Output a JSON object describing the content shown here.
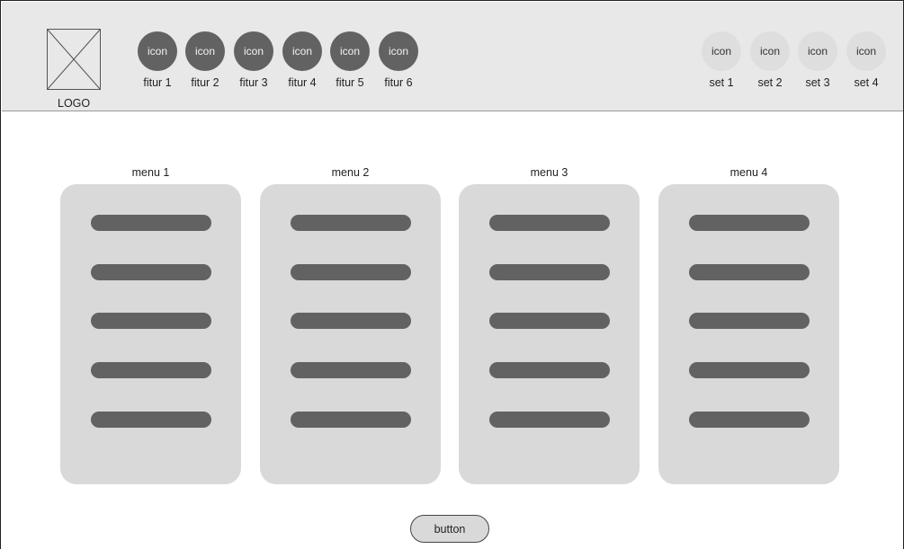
{
  "header": {
    "logo_label": "LOGO",
    "features": [
      {
        "icon_text": "icon",
        "label": "fitur 1"
      },
      {
        "icon_text": "icon",
        "label": "fitur 2"
      },
      {
        "icon_text": "icon",
        "label": "fitur 3"
      },
      {
        "icon_text": "icon",
        "label": "fitur 4"
      },
      {
        "icon_text": "icon",
        "label": "fitur 5"
      },
      {
        "icon_text": "icon",
        "label": "fitur 6"
      }
    ],
    "settings": [
      {
        "icon_text": "icon",
        "label": "set 1"
      },
      {
        "icon_text": "icon",
        "label": "set 2"
      },
      {
        "icon_text": "icon",
        "label": "set 3"
      },
      {
        "icon_text": "icon",
        "label": "set 4"
      }
    ]
  },
  "menus": [
    {
      "title": "menu 1"
    },
    {
      "title": "menu 2"
    },
    {
      "title": "menu 3"
    },
    {
      "title": "menu 4"
    }
  ],
  "button": {
    "label": "button"
  },
  "colors": {
    "header_bg": "#e8e8e8",
    "feature_icon": "#626262",
    "setting_icon": "#dedede",
    "card_bg": "#d9d9d9",
    "placeholder_bar": "#626262"
  }
}
